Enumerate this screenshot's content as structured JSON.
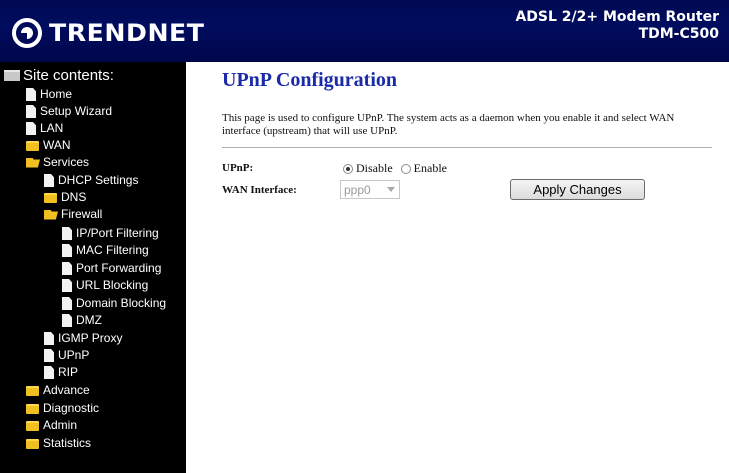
{
  "header": {
    "logo_text": "TRENDNET",
    "product_line1": "ADSL 2/2+ Modem Router",
    "product_line2": "TDM-C500",
    "background_color": "#000a52"
  },
  "sidebar": {
    "title": "Site contents:",
    "items": [
      {
        "label": "Home",
        "icon": "page-icon"
      },
      {
        "label": "Setup Wizard",
        "icon": "page-icon"
      },
      {
        "label": "LAN",
        "icon": "page-icon"
      },
      {
        "label": "WAN",
        "icon": "folder-icon"
      },
      {
        "label": "Services",
        "icon": "folder-open-icon"
      },
      {
        "label": "DHCP Settings",
        "icon": "page-icon"
      },
      {
        "label": "DNS",
        "icon": "folder-icon"
      },
      {
        "label": "Firewall",
        "icon": "folder-open-icon"
      },
      {
        "label": "IP/Port Filtering",
        "icon": "page-icon"
      },
      {
        "label": "MAC Filtering",
        "icon": "page-icon"
      },
      {
        "label": "Port Forwarding",
        "icon": "page-icon"
      },
      {
        "label": "URL Blocking",
        "icon": "page-icon"
      },
      {
        "label": "Domain Blocking",
        "icon": "page-icon"
      },
      {
        "label": "DMZ",
        "icon": "page-icon"
      },
      {
        "label": "IGMP Proxy",
        "icon": "page-icon"
      },
      {
        "label": "UPnP",
        "icon": "page-icon"
      },
      {
        "label": "RIP",
        "icon": "page-icon"
      },
      {
        "label": "Advance",
        "icon": "folder-icon"
      },
      {
        "label": "Diagnostic",
        "icon": "folder-icon"
      },
      {
        "label": "Admin",
        "icon": "folder-icon"
      },
      {
        "label": "Statistics",
        "icon": "folder-icon"
      }
    ]
  },
  "main": {
    "title": "UPnP Configuration",
    "description": "This page is used to configure UPnP. The system acts as a daemon when you enable it and select WAN interface (upstream) that will use UPnP.",
    "upnp_label": "UPnP:",
    "upnp_options": [
      {
        "label": "Disable",
        "checked": true
      },
      {
        "label": "Enable",
        "checked": false
      }
    ],
    "wan_interface_label": "WAN Interface:",
    "wan_interface_value": "ppp0",
    "apply_button": "Apply Changes",
    "title_color": "#1a2aa8"
  }
}
